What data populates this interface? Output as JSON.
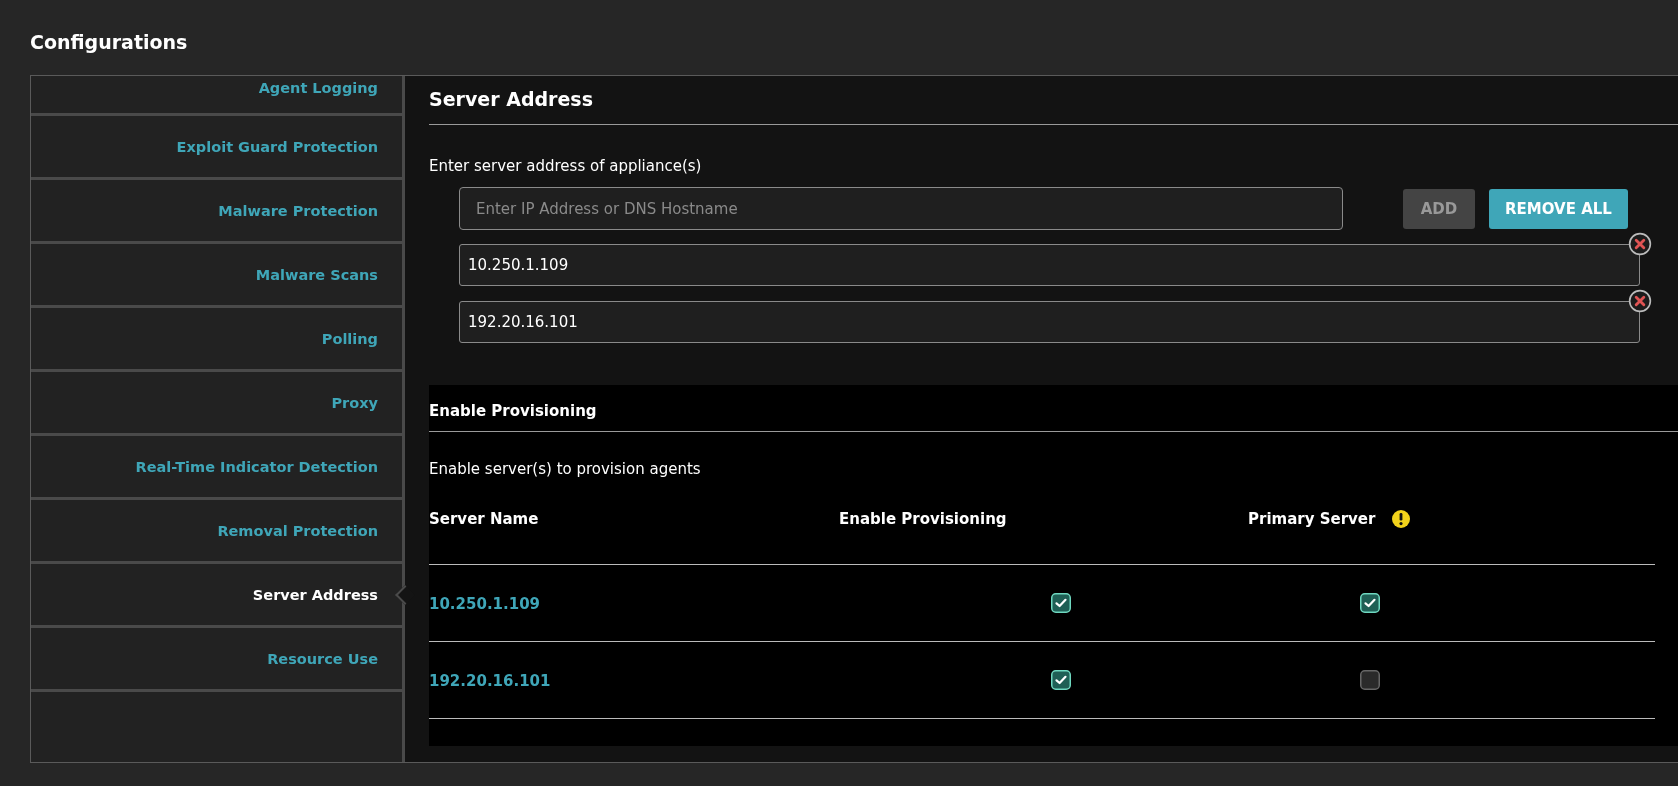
{
  "window": {
    "title": "Configurations"
  },
  "sidebar": {
    "items": [
      {
        "label": "Agent Logging",
        "selected": false
      },
      {
        "label": "Exploit Guard Protection",
        "selected": false
      },
      {
        "label": "Malware Protection",
        "selected": false
      },
      {
        "label": "Malware Scans",
        "selected": false
      },
      {
        "label": "Polling",
        "selected": false
      },
      {
        "label": "Proxy",
        "selected": false
      },
      {
        "label": "Real-Time Indicator Detection",
        "selected": false
      },
      {
        "label": "Removal Protection",
        "selected": false
      },
      {
        "label": "Server Address",
        "selected": true
      },
      {
        "label": "Resource Use",
        "selected": false
      }
    ]
  },
  "server_address": {
    "title": "Server Address",
    "label": "Enter server address of appliance(s)",
    "address_input": {
      "placeholder": "Enter IP Address or DNS Hostname"
    },
    "buttons": [
      {
        "label": "ADD",
        "disabled": true
      },
      {
        "label": "REMOVE ALL",
        "disabled": false
      }
    ],
    "addresses": [
      {
        "value": "10.250.1.109"
      },
      {
        "value": "192.20.16.101"
      }
    ]
  },
  "provisioning": {
    "title": "Enable Provisioning",
    "description": "Enable server(s) to provision agents",
    "columns": [
      "Server Name",
      "Enable Provisioning",
      "Primary Server"
    ],
    "rows": [
      {
        "server": "10.250.1.109",
        "provisioning": true,
        "primary": true
      },
      {
        "server": "192.20.16.101",
        "provisioning": true,
        "primary": false
      }
    ]
  }
}
